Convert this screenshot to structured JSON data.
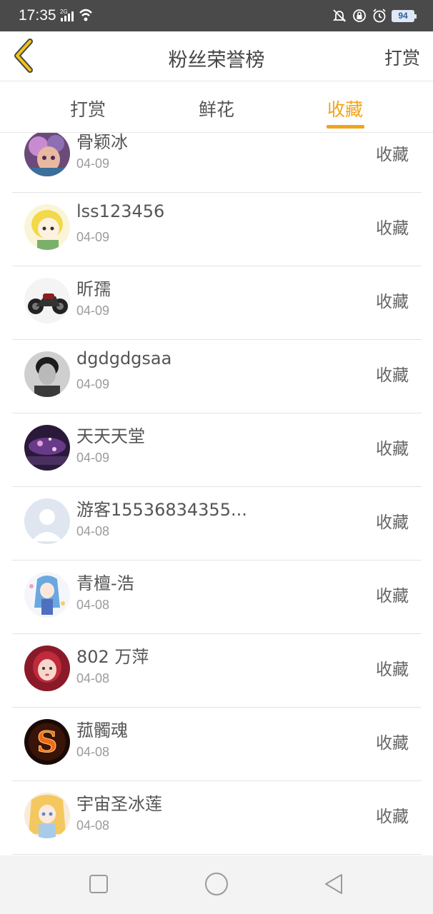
{
  "status_bar": {
    "time": "17:35",
    "network": "2G",
    "battery": "94",
    "icons": [
      "mute-icon",
      "lock-rotation-icon",
      "alarm-icon",
      "battery-icon"
    ]
  },
  "header": {
    "title": "粉丝荣誉榜",
    "action": "打赏",
    "back_icon": "chevron-left-icon"
  },
  "tabs": [
    {
      "label": "打赏",
      "active": false
    },
    {
      "label": "鲜花",
      "active": false
    },
    {
      "label": "收藏",
      "active": true
    }
  ],
  "colors": {
    "accent": "#f0a41b",
    "text": "#555555",
    "subtext": "#9b9b9b"
  },
  "fans": [
    {
      "name": "骨颖冰",
      "date": "04-09",
      "action": "收藏"
    },
    {
      "name": "lss123456",
      "date": "04-09",
      "action": "收藏"
    },
    {
      "name": "昕孺",
      "date": "04-09",
      "action": "收藏"
    },
    {
      "name": "dgdgdgsaa",
      "date": "04-09",
      "action": "收藏"
    },
    {
      "name": "天天天堂",
      "date": "04-09",
      "action": "收藏"
    },
    {
      "name": "游客15536834355...",
      "date": "04-08",
      "action": "收藏"
    },
    {
      "name": "青檀-浩",
      "date": "04-08",
      "action": "收藏"
    },
    {
      "name": "802 万萍",
      "date": "04-08",
      "action": "收藏"
    },
    {
      "name": "菰髑魂",
      "date": "04-08",
      "action": "收藏"
    },
    {
      "name": "宇宙圣冰莲",
      "date": "04-08",
      "action": "收藏"
    }
  ],
  "nav_bar": [
    "square-icon",
    "circle-icon",
    "triangle-back-icon"
  ]
}
